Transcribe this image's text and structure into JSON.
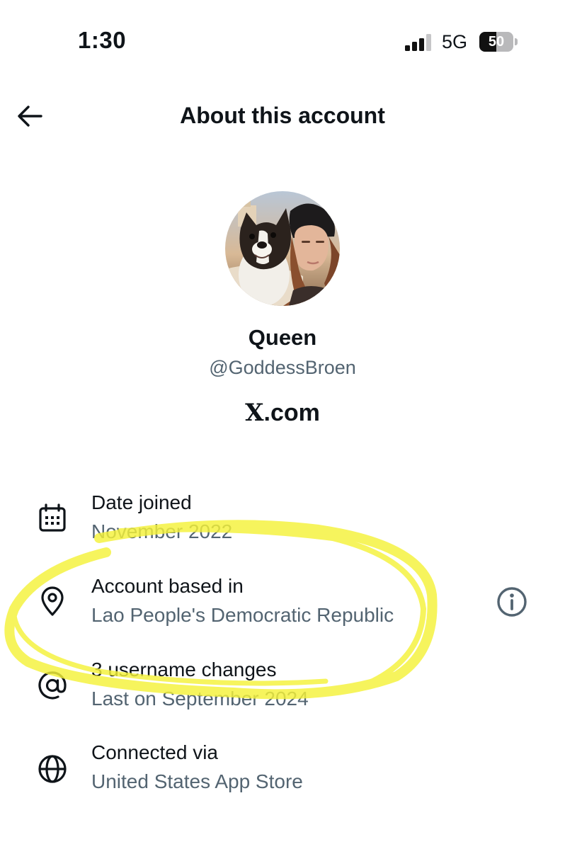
{
  "status_bar": {
    "time": "1:30",
    "network": "5G",
    "battery_level": "50",
    "signal_bars": 3
  },
  "header": {
    "title": "About this account",
    "back_icon": "arrow-left-icon"
  },
  "profile": {
    "display_name": "Queen",
    "handle": "@GoddessBroen",
    "site": ".com",
    "site_logo": "X"
  },
  "rows": [
    {
      "icon": "calendar-icon",
      "label": "Date joined",
      "value": "November 2022"
    },
    {
      "icon": "location-pin-icon",
      "label": "Account based in",
      "value": "Lao People's Democratic Republic",
      "info_icon": "info-icon"
    },
    {
      "icon": "at-sign-icon",
      "label": "3 username changes",
      "value": "Last on September 2024"
    },
    {
      "icon": "globe-icon",
      "label": "Connected via",
      "value": "United States App Store"
    }
  ],
  "colors": {
    "text_primary": "#0f1419",
    "text_secondary": "#536471",
    "highlight_marker": "#f5f23a"
  }
}
